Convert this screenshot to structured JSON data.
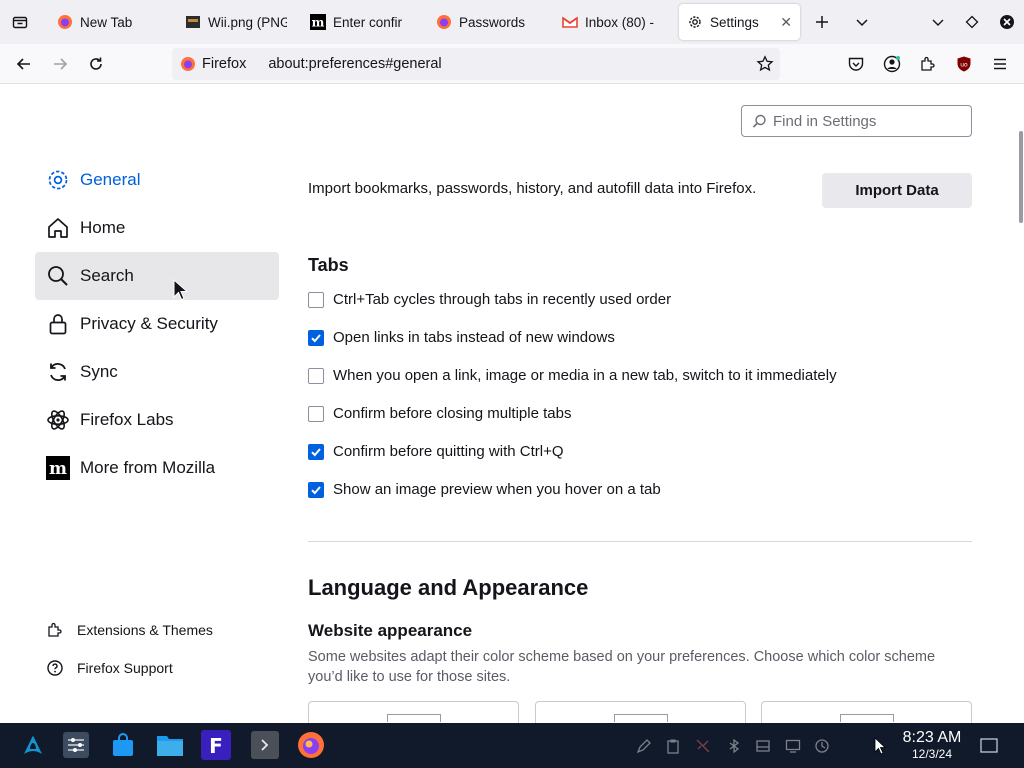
{
  "tabs": [
    {
      "label": "New Tab",
      "icon": "firefox-icon",
      "active": false
    },
    {
      "label": "Wii.png (PNG",
      "icon": "image-icon",
      "active": false
    },
    {
      "label": "Enter confir",
      "icon": "mozilla-m-icon",
      "active": false
    },
    {
      "label": "Passwords",
      "icon": "firefox-icon",
      "active": false
    },
    {
      "label": "Inbox (80) - ",
      "icon": "gmail-icon",
      "active": false
    },
    {
      "label": "Settings",
      "icon": "gear-icon",
      "active": true
    }
  ],
  "urlbar": {
    "identity": "Firefox",
    "url": "about:preferences#general"
  },
  "search": {
    "placeholder": "Find in Settings"
  },
  "sidebar": {
    "items": [
      {
        "label": "General",
        "icon": "gear-icon"
      },
      {
        "label": "Home",
        "icon": "home-icon"
      },
      {
        "label": "Search",
        "icon": "search-icon"
      },
      {
        "label": "Privacy & Security",
        "icon": "lock-icon"
      },
      {
        "label": "Sync",
        "icon": "sync-icon"
      },
      {
        "label": "Firefox Labs",
        "icon": "labs-icon"
      },
      {
        "label": "More from Mozilla",
        "icon": "mozilla-m-icon"
      }
    ],
    "footer": [
      {
        "label": "Extensions & Themes",
        "icon": "puzzle-icon"
      },
      {
        "label": "Firefox Support",
        "icon": "help-icon"
      }
    ]
  },
  "import": {
    "text": "Import bookmarks, passwords, history, and autofill data into Firefox.",
    "button": "Import Data"
  },
  "tabs_section": {
    "title": "Tabs",
    "options": [
      {
        "label": "Ctrl+Tab cycles through tabs in recently used order",
        "checked": false
      },
      {
        "label": "Open links in tabs instead of new windows",
        "checked": true
      },
      {
        "label": "When you open a link, image or media in a new tab, switch to it immediately",
        "checked": false
      },
      {
        "label": "Confirm before closing multiple tabs",
        "checked": false
      },
      {
        "label": "Confirm before quitting with Ctrl+Q",
        "checked": true
      },
      {
        "label": "Show an image preview when you hover on a tab",
        "checked": true
      }
    ]
  },
  "language": {
    "title": "Language and Appearance",
    "website_appearance": {
      "title": "Website appearance",
      "description": "Some websites adapt their color scheme based on your preferences. Choose which color scheme you’d like to use for those sites."
    }
  },
  "taskbar": {
    "time": "8:23 AM",
    "date": "12/3/24"
  },
  "colors": {
    "accent": "#0061e0",
    "taskbar": "#101a2a",
    "toolbar": "#f9f9fb"
  }
}
